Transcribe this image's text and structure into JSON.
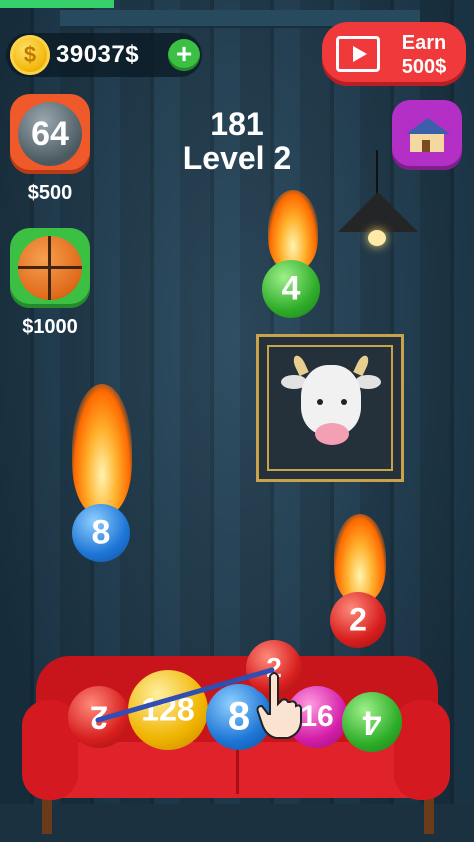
{
  "hud": {
    "progress_fraction": 0.24,
    "coins": "39037$",
    "coin_symbol": "$",
    "add_coins_label": "+",
    "earn": {
      "line1": "Earn",
      "line2": "500$"
    }
  },
  "shop": [
    {
      "ball_label": "64",
      "price": "$500",
      "icon": "ball-64-icon"
    },
    {
      "ball_label": "",
      "price": "$1000",
      "icon": "basketball-icon"
    }
  ],
  "score": "181",
  "level": "Level 2",
  "balls": {
    "falling_4": "4",
    "falling_8": "8",
    "falling_2": "2",
    "sofa_2": "2",
    "sofa_128": "128",
    "sofa_8": "8",
    "sofa_2b": "2",
    "sofa_16": "16",
    "sofa_4": "4"
  },
  "colors": {
    "coin": "#f2b70a",
    "earn_button": "#f0393a",
    "sofa": "#d41a20",
    "progress": "#35d06a"
  }
}
